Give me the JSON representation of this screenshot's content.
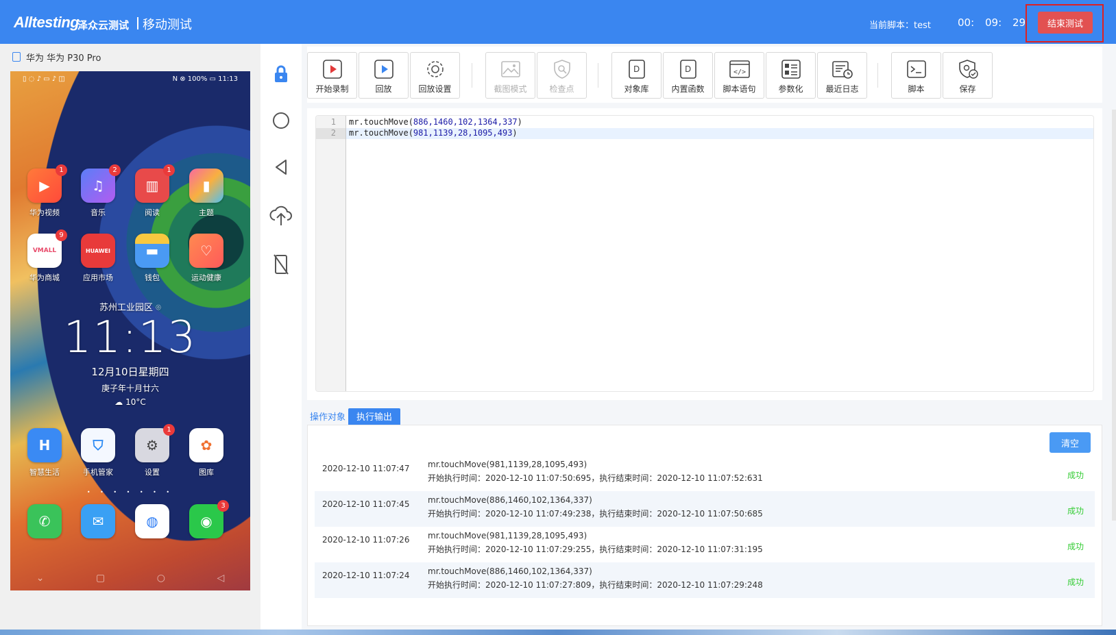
{
  "header": {
    "logo": "Alltesting",
    "logo_sub": "泽众云测试",
    "module": "移动测试",
    "current_script_label": "当前脚本：test",
    "timer": {
      "h": "00:",
      "m": "09:",
      "s": "29"
    },
    "end_button": "结束测试",
    "colors": {
      "bar": "#3a86f0",
      "end_button": "#e25151"
    }
  },
  "device": {
    "name": "华为 华为 P30 Pro",
    "status_left": "▯ ◌ ♪ ▭ ♪ ◫",
    "status_right": "N ⊗ 100% ▭ 11:13",
    "apps_row1": [
      {
        "label": "华为视频",
        "badge": "1",
        "icon": "video-icon"
      },
      {
        "label": "音乐",
        "badge": "2",
        "icon": "music-icon"
      },
      {
        "label": "阅读",
        "badge": "1",
        "icon": "book-icon"
      },
      {
        "label": "主题",
        "badge": "",
        "icon": "brush-icon"
      }
    ],
    "apps_row2": [
      {
        "label": "华为商城",
        "badge": "9",
        "icon": "vmall-icon"
      },
      {
        "label": "应用市场",
        "badge": "",
        "icon": "huawei-icon"
      },
      {
        "label": "钱包",
        "badge": "",
        "icon": "wallet-icon"
      },
      {
        "label": "运动健康",
        "badge": "",
        "icon": "heart-icon"
      }
    ],
    "location": "苏州工业园区",
    "clock": "11:13",
    "date": "12月10日星期四",
    "lunar": "庚子年十月廿六",
    "weather": "10°C",
    "apps_row3": [
      {
        "label": "智慧生活",
        "badge": "",
        "icon": "smart-life-icon"
      },
      {
        "label": "手机管家",
        "badge": "",
        "icon": "shield-icon"
      },
      {
        "label": "设置",
        "badge": "1",
        "icon": "settings-icon"
      },
      {
        "label": "图库",
        "badge": "",
        "icon": "gallery-icon"
      }
    ],
    "dock": [
      {
        "badge": "",
        "icon": "phone-icon"
      },
      {
        "badge": "",
        "icon": "message-icon"
      },
      {
        "badge": "",
        "icon": "browser-icon"
      },
      {
        "badge": "3",
        "icon": "wechat-icon"
      }
    ]
  },
  "toolbar": {
    "record": "开始录制",
    "playback": "回放",
    "playback_settings": "回放设置",
    "screenshot_mode": "截图模式",
    "checkpoint": "检查点",
    "object_library": "对象库",
    "builtin_functions": "内置函数",
    "script_statement": "脚本语句",
    "parameterize": "参数化",
    "recent_log": "最近日志",
    "script": "脚本",
    "save": "保存"
  },
  "editor": {
    "lines": [
      {
        "n": "1",
        "fn": "mr.touchMove(",
        "args": "886,1460,102,1364,337",
        "end": ")"
      },
      {
        "n": "2",
        "fn": "mr.touchMove(",
        "args": "981,1139,28,1095,493",
        "end": ")"
      }
    ]
  },
  "tabs": {
    "objects": "操作对象",
    "output": "执行输出"
  },
  "output": {
    "clear": "清空",
    "rows": [
      {
        "ts": "2020-12-10 11:07:47",
        "cmd": "mr.touchMove(981,1139,28,1095,493)",
        "times": "开始执行时间：2020-12-10 11:07:50:695，执行结束时间：2020-12-10 11:07:52:631",
        "status": "成功"
      },
      {
        "ts": "2020-12-10 11:07:45",
        "cmd": "mr.touchMove(886,1460,102,1364,337)",
        "times": "开始执行时间：2020-12-10 11:07:49:238，执行结束时间：2020-12-10 11:07:50:685",
        "status": "成功"
      },
      {
        "ts": "2020-12-10 11:07:26",
        "cmd": "mr.touchMove(981,1139,28,1095,493)",
        "times": "开始执行时间：2020-12-10 11:07:29:255，执行结束时间：2020-12-10 11:07:31:195",
        "status": "成功"
      },
      {
        "ts": "2020-12-10 11:07:24",
        "cmd": "mr.touchMove(886,1460,102,1364,337)",
        "times": "开始执行时间：2020-12-10 11:07:27:809，执行结束时间：2020-12-10 11:07:29:248",
        "status": "成功"
      }
    ]
  }
}
